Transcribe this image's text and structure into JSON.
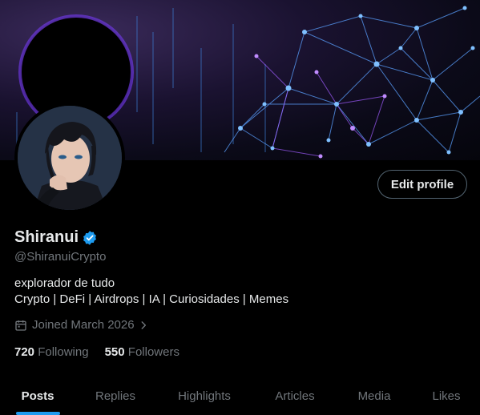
{
  "profile": {
    "name": "Shiranui",
    "handle": "@ShiranuiCrypto",
    "bio_line1": "explorador de tudo",
    "bio_line2": "Crypto | DeFi | Airdrops | IA | Curiosidades | Memes",
    "joined": "Joined March 2026",
    "following_count": "720",
    "following_label": "Following",
    "followers_count": "550",
    "followers_label": "Followers",
    "edit_label": "Edit profile"
  },
  "tabs": [
    {
      "label": "Posts",
      "active": true
    },
    {
      "label": "Replies"
    },
    {
      "label": "Highlights"
    },
    {
      "label": "Articles"
    },
    {
      "label": "Media"
    },
    {
      "label": "Likes"
    }
  ],
  "colors": {
    "accent": "#1d9bf0",
    "secondary_text": "#71767b",
    "primary_text": "#e7e9ea",
    "background": "#000000"
  },
  "icons": [
    "verified-badge-icon",
    "calendar-icon",
    "chevron-right-icon"
  ]
}
